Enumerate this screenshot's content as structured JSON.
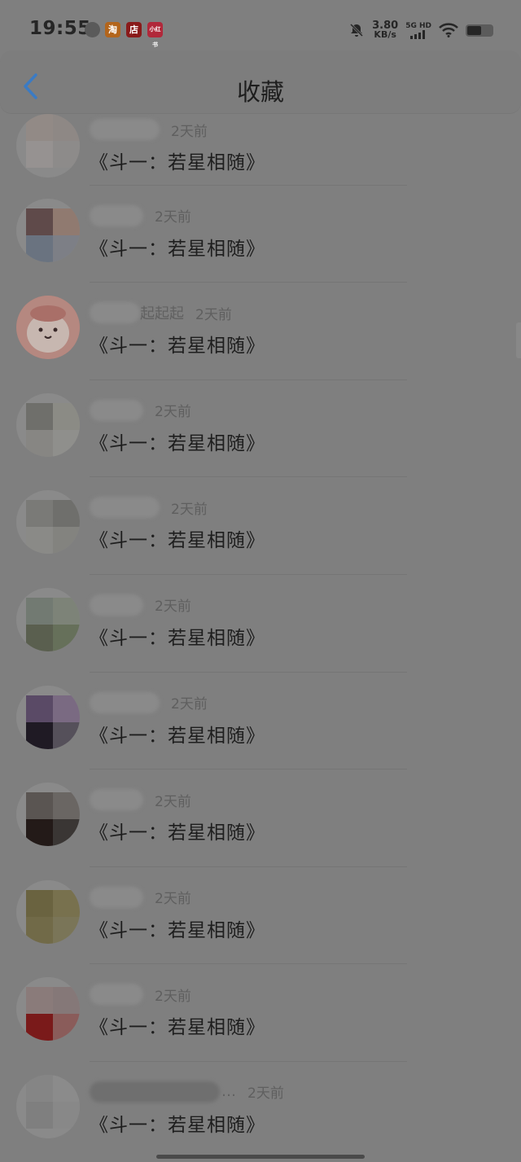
{
  "status_bar": {
    "time": "19:55",
    "apps": [
      "淘",
      "店",
      "小红书"
    ],
    "net_speed_value": "3.80",
    "net_speed_unit": "KB/s",
    "network_type": "5G HD",
    "icons": [
      "bell-off-icon",
      "signal-icon",
      "wifi-icon",
      "battery-icon"
    ]
  },
  "header": {
    "title": "收藏",
    "back_icon": "chevron-left-icon",
    "accent": "#3b7bc4"
  },
  "favorites": [
    {
      "name": "",
      "time": "2天前",
      "content": "《斗一：若星相随》"
    },
    {
      "name": "",
      "time": "2天前",
      "content": "《斗一：若星相随》"
    },
    {
      "name": "起起起",
      "time": "2天前",
      "content": "《斗一：若星相随》"
    },
    {
      "name": "",
      "time": "2天前",
      "content": "《斗一：若星相随》"
    },
    {
      "name": "",
      "time": "2天前",
      "content": "《斗一：若星相随》"
    },
    {
      "name": "",
      "time": "2天前",
      "content": "《斗一：若星相随》"
    },
    {
      "name": "",
      "time": "2天前",
      "content": "《斗一：若星相随》"
    },
    {
      "name": "",
      "time": "2天前",
      "content": "《斗一：若星相随》"
    },
    {
      "name": "",
      "time": "2天前",
      "content": "《斗一：若星相随》"
    },
    {
      "name": "",
      "time": "2天前",
      "content": "《斗一：若星相随》"
    },
    {
      "name": "…",
      "time": "2天前",
      "content": "《斗一：若星相随》"
    }
  ]
}
